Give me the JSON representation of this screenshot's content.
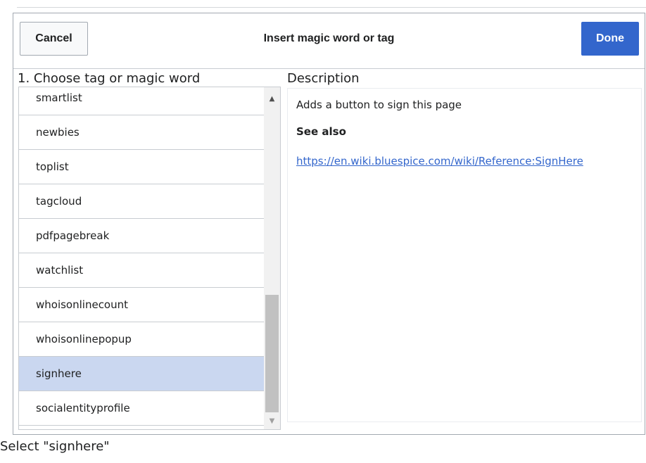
{
  "dialog": {
    "title": "Insert magic word or tag",
    "cancel_label": "Cancel",
    "done_label": "Done"
  },
  "list_panel": {
    "heading": "1. Choose tag or magic word",
    "items": [
      {
        "label": "smartlist",
        "selected": false
      },
      {
        "label": "newbies",
        "selected": false
      },
      {
        "label": "toplist",
        "selected": false
      },
      {
        "label": "tagcloud",
        "selected": false
      },
      {
        "label": "pdfpagebreak",
        "selected": false
      },
      {
        "label": "watchlist",
        "selected": false
      },
      {
        "label": "whoisonlinecount",
        "selected": false
      },
      {
        "label": "whoisonlinepopup",
        "selected": false
      },
      {
        "label": "signhere",
        "selected": true
      },
      {
        "label": "socialentityprofile",
        "selected": false
      }
    ],
    "scroll_position": 0.78
  },
  "description_panel": {
    "heading": "Description",
    "text": "Adds a button to sign this page",
    "see_also_label": "See also",
    "link": "https://en.wiki.bluespice.com/wiki/Reference:SignHere"
  },
  "caption": "Select \"signhere\"",
  "colors": {
    "primary": "#3366cc",
    "selected_row": "#cad7f0",
    "border": "#c8ccd1"
  }
}
